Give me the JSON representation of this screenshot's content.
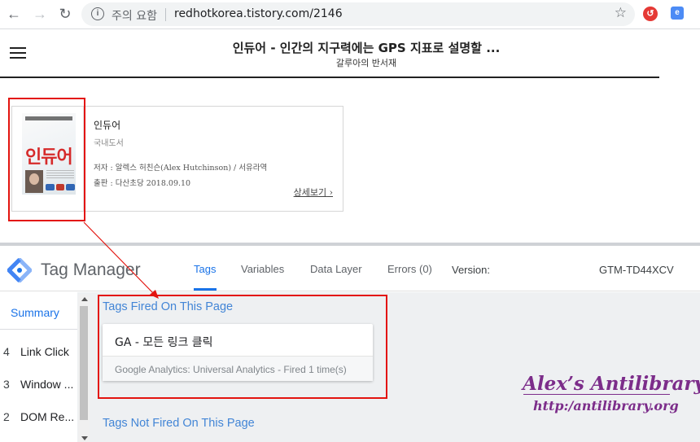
{
  "browser": {
    "back_icon": "arrow-left-icon",
    "forward_icon": "arrow-right-icon",
    "reload_icon": "reload-icon",
    "security_warning": "주의 요함",
    "url": "redhotkorea.tistory.com/2146",
    "bookmark_icon": "star-icon"
  },
  "page": {
    "title": "인듀어 - 인간의 지구력에는 GPS 지표로 설명할 ...",
    "subtitle": "갈루아의 반서재"
  },
  "book": {
    "cover_title": "인듀어",
    "name": "인듀어",
    "category": "국내도서",
    "author": "저자 : 알렉스 허친슨(Alex Hutchinson) / 서유라역",
    "publisher": "출판 : 다산초당 2018.09.10",
    "more_link": "상세보기"
  },
  "tag_manager": {
    "product_name": "Tag Manager",
    "tabs": [
      {
        "label": "Tags",
        "active": true
      },
      {
        "label": "Variables",
        "active": false
      },
      {
        "label": "Data Layer",
        "active": false
      },
      {
        "label": "Errors (0)",
        "active": false
      }
    ],
    "version_label": "Version:",
    "version_value": "GTM-TD44XCV",
    "sidebar": {
      "summary": "Summary",
      "events": [
        {
          "number": "4",
          "label": "Link Click"
        },
        {
          "number": "3",
          "label": "Window ..."
        },
        {
          "number": "2",
          "label": "DOM Re..."
        }
      ]
    },
    "fired_title": "Tags Fired On This Page",
    "fired_tags": [
      {
        "name": "GA - 모든 링크 클릭",
        "status": "Google Analytics: Universal Analytics - Fired 1 time(s)"
      }
    ],
    "not_fired_title": "Tags Not Fired On This Page"
  },
  "watermark": {
    "title": "Alex’s Antilibrary",
    "url": "http:/antilibrary.org"
  },
  "colors": {
    "accent": "#1a73e8",
    "annotation": "#e3140f",
    "watermark": "#7c2d8a"
  }
}
